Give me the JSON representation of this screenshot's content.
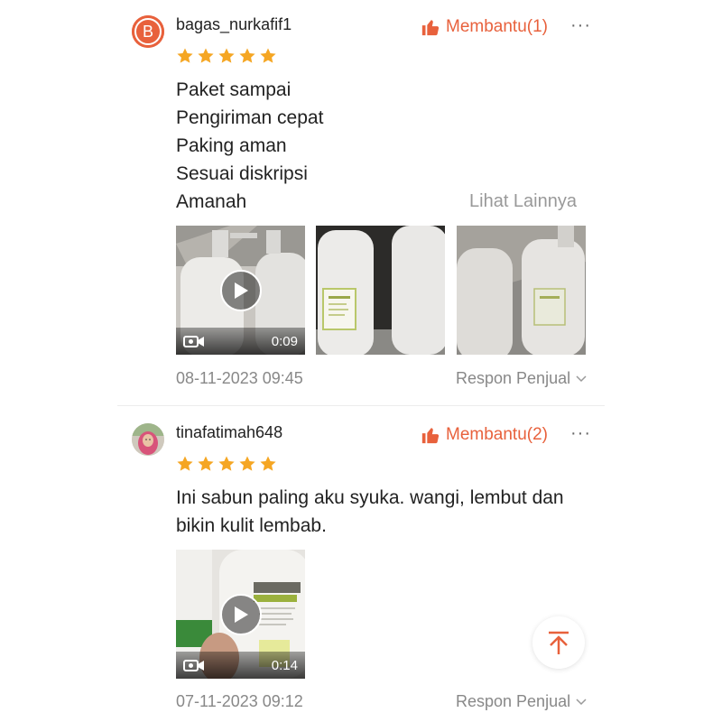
{
  "reviews": [
    {
      "avatar_letter": "B",
      "username": "bagas_nurkafif1",
      "helpful_label": "Membantu(1)",
      "more_label": "···",
      "rating": 5,
      "text_lines": [
        "Paket sampai",
        "Pengiriman cepat",
        "Paking aman",
        "Sesuai diskripsi",
        "Amanah"
      ],
      "see_more": "Lihat Lainnya",
      "media": [
        {
          "type": "video",
          "duration": "0:09"
        },
        {
          "type": "image"
        },
        {
          "type": "image"
        }
      ],
      "date": "08-11-2023 09:45",
      "reply_label": "Respon Penjual"
    },
    {
      "avatar_letter": "",
      "username": "tinafatimah648",
      "helpful_label": "Membantu(2)",
      "more_label": "···",
      "rating": 5,
      "text_lines": [
        "Ini sabun paling aku syuka. wangi, lembut dan",
        "bikin kulit lembab."
      ],
      "media": [
        {
          "type": "video",
          "duration": "0:14"
        }
      ],
      "date": "07-11-2023 09:12",
      "reply_label": "Respon Penjual"
    }
  ],
  "colors": {
    "accent": "#e8613c",
    "star": "#f5a623",
    "muted": "#888888"
  },
  "icons": {
    "helpful": "thumbs-up-icon",
    "play": "play-icon",
    "video": "video-camera-icon",
    "reply": "chevron-down-icon",
    "scroll_top": "arrow-up-icon"
  }
}
